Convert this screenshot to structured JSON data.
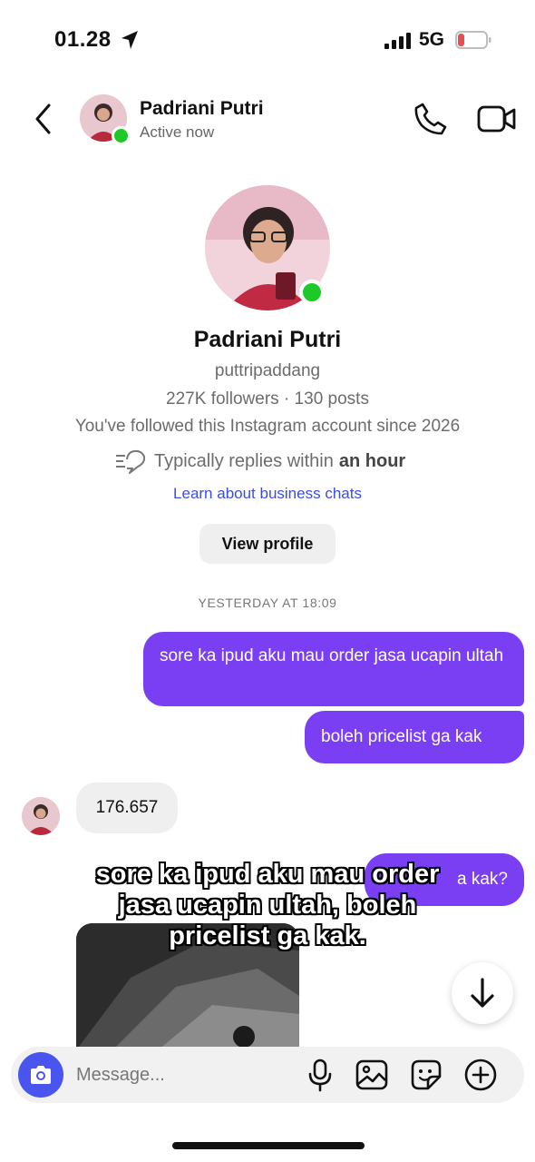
{
  "status_bar": {
    "time": "01.28",
    "network": "5G",
    "battery": "18",
    "battery_color": "#e65050"
  },
  "header": {
    "name": "Padriani Putri",
    "status": "Active now"
  },
  "profile": {
    "name": "Padriani Putri",
    "handle": "puttripaddang",
    "stats": "227K followers · 130 posts",
    "followed_since": "You've followed this Instagram account since 2026",
    "replies_prefix": "Typically replies within",
    "replies_time": "an hour",
    "learn_link": "Learn about business chats",
    "view_profile": "View profile"
  },
  "chat": {
    "timestamp": "YESTERDAY AT 18:09",
    "messages": [
      {
        "from": "me",
        "text": "sore ka ipud aku mau order jasa ucapin ultah"
      },
      {
        "from": "me",
        "text": "boleh pricelist ga kak"
      },
      {
        "from": "them",
        "text": "176.657"
      },
      {
        "from": "me",
        "text": "a kak?"
      }
    ]
  },
  "caption": {
    "lines": [
      "sore ka ipud aku mau order",
      "jasa ucapin ultah, boleh",
      "pricelist ga kak."
    ]
  },
  "composer": {
    "placeholder": "Message..."
  },
  "colors": {
    "outgoing_bubble": "#7a3ff2",
    "incoming_bubble": "#efefef",
    "link": "#3d4ce0",
    "camera_button": "#4a55f0",
    "online_dot": "#1ec927"
  },
  "icons": [
    "location-arrow-icon",
    "signal-icon",
    "battery-icon",
    "back-icon",
    "phone-icon",
    "video-icon",
    "replies-fast-icon",
    "scroll-down-icon",
    "camera-icon",
    "microphone-icon",
    "gallery-icon",
    "sticker-icon",
    "plus-icon"
  ]
}
